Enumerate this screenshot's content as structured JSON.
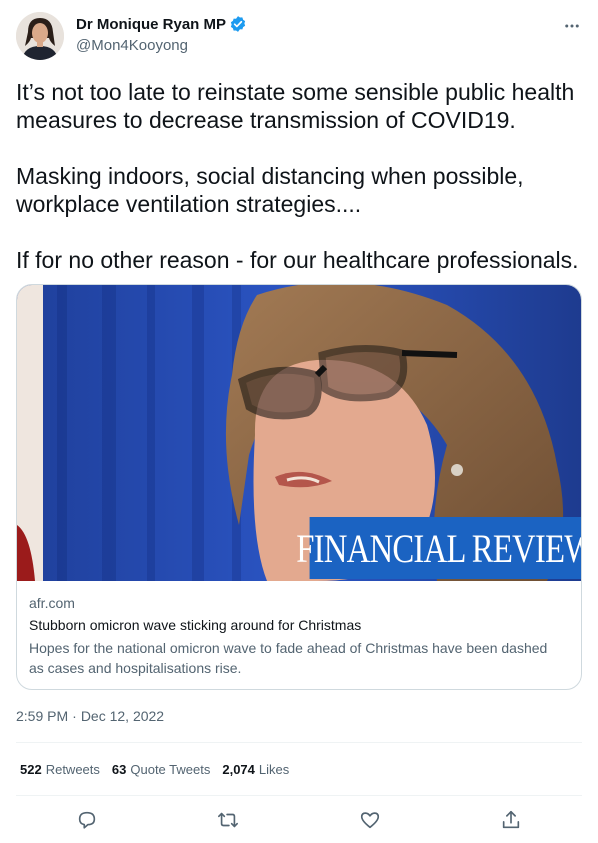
{
  "author": {
    "display_name": "Dr Monique Ryan MP",
    "handle": "@Mon4Kooyong",
    "verified": true
  },
  "tweet": {
    "paragraphs": [
      "It’s not too late to reinstate some sensible public health measures to decrease transmission of COVID19.",
      "Masking indoors, social distancing when possible, workplace ventilation strategies....",
      "If for no other reason - for our healthcare professionals."
    ],
    "lines": [
      [
        "It’s not too late to reinstate some sensible public health",
        "measures to decrease transmission of COVID19."
      ],
      [
        "Masking indoors, social distancing when possible,",
        "workplace ventilation strategies...."
      ],
      [
        "If for no other reason - for our healthcare professionals."
      ]
    ]
  },
  "card": {
    "brand_text": "FINANCIAL REVIEW",
    "domain": "afr.com",
    "title": "Stubborn omicron wave sticking around for Christmas",
    "description": "Hopes for the national omicron wave to fade ahead of Christmas have been dashed as cases and hospitalisations rise."
  },
  "meta": {
    "time": "2:59 PM",
    "separator": "·",
    "date": "Dec 12, 2022"
  },
  "stats": {
    "retweets": {
      "count": "522",
      "label": "Retweets"
    },
    "quote_tweets": {
      "count": "63",
      "label": "Quote Tweets"
    },
    "likes": {
      "count": "2,074",
      "label": "Likes"
    }
  },
  "actions": [
    {
      "name": "reply",
      "icon": "reply-icon"
    },
    {
      "name": "retweet",
      "icon": "retweet-icon"
    },
    {
      "name": "like",
      "icon": "like-icon"
    },
    {
      "name": "share",
      "icon": "share-icon"
    }
  ],
  "colors": {
    "text": "#0f1419",
    "secondary": "#536471",
    "verified": "#1d9bf0",
    "brand_blue": "#1b63c2",
    "border": "#cfd9de"
  }
}
